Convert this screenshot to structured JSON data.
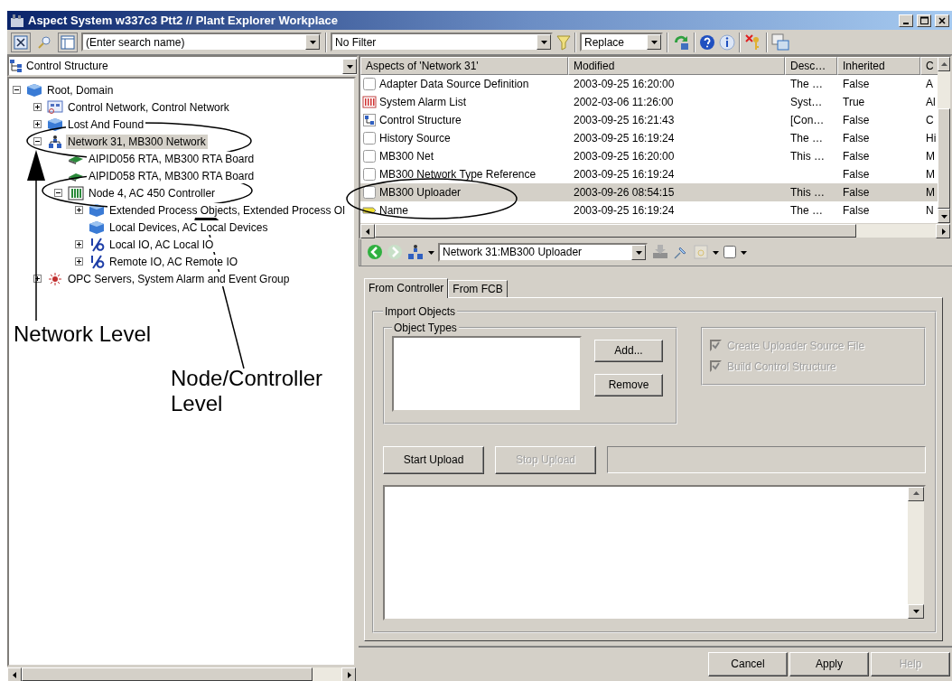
{
  "window": {
    "title": "Aspect System w337c3 Ptt2 // Plant Explorer Workplace"
  },
  "toolbar": {
    "search": {
      "placeholder": "(Enter search name)"
    },
    "filter": {
      "value": "No Filter"
    },
    "mode": {
      "value": "Replace"
    }
  },
  "tree": {
    "selector": "Control Structure",
    "items": [
      {
        "label": "Root, Domain",
        "kind": "domain",
        "expanded": true,
        "selected": false,
        "children": [
          {
            "label": "Control Network, Control Network",
            "kind": "network-folder",
            "expanded": false,
            "selected": false
          },
          {
            "label": "Lost And Found",
            "kind": "folder",
            "expanded": false,
            "selected": false
          },
          {
            "label": "Network 31, MB300 Network",
            "kind": "network",
            "expanded": true,
            "selected": true,
            "children": [
              {
                "label": "AIPID056 RTA, MB300 RTA Board",
                "kind": "board",
                "selected": false
              },
              {
                "label": "AIPID058 RTA, MB300 RTA Board",
                "kind": "board",
                "selected": false
              },
              {
                "label": "Node 4, AC 450 Controller",
                "kind": "controller",
                "expanded": true,
                "selected": false,
                "children": [
                  {
                    "label": "Extended Process Objects, Extended Process Ol",
                    "kind": "folder",
                    "expanded": false,
                    "selected": false
                  },
                  {
                    "label": "Local Devices, AC Local Devices",
                    "kind": "folder",
                    "selected": false
                  },
                  {
                    "label": "Local IO, AC Local IO",
                    "kind": "io",
                    "expanded": false,
                    "selected": false
                  },
                  {
                    "label": "Remote IO, AC Remote IO",
                    "kind": "io",
                    "expanded": false,
                    "selected": false
                  }
                ]
              }
            ]
          },
          {
            "label": "OPC Servers, System Alarm and Event Group",
            "kind": "opc",
            "expanded": false,
            "selected": false
          }
        ]
      }
    ]
  },
  "aspects": {
    "columns": [
      "Aspects of 'Network 31'",
      "Modified",
      "Desc…",
      "Inherited",
      "C"
    ],
    "rows": [
      {
        "kind": "aspect",
        "selected": false,
        "cells": [
          "Adapter Data Source Definition",
          "2003-09-25 16:20:00",
          "The …",
          "False",
          "A"
        ]
      },
      {
        "kind": "alarm",
        "selected": false,
        "cells": [
          "System Alarm List",
          "2002-03-06 11:26:00",
          "Syst…",
          "True",
          "Al"
        ]
      },
      {
        "kind": "structure",
        "selected": false,
        "cells": [
          "Control Structure",
          "2003-09-25 16:21:43",
          "[Con…",
          "False",
          "C"
        ]
      },
      {
        "kind": "aspect",
        "selected": false,
        "cells": [
          "History Source",
          "2003-09-25 16:19:24",
          "The …",
          "False",
          "Hi"
        ]
      },
      {
        "kind": "aspect",
        "selected": false,
        "cells": [
          "MB300 Net",
          "2003-09-25 16:20:00",
          "This …",
          "False",
          "M"
        ]
      },
      {
        "kind": "aspect",
        "selected": false,
        "cells": [
          "MB300 Network Type Reference",
          "2003-09-25 16:19:24",
          "",
          "False",
          "M"
        ]
      },
      {
        "kind": "aspect",
        "selected": true,
        "cells": [
          "MB300 Uploader",
          "2003-09-26 08:54:15",
          "This …",
          "False",
          "M"
        ]
      },
      {
        "kind": "name",
        "selected": false,
        "cells": [
          "Name",
          "2003-09-25 16:19:24",
          "The …",
          "False",
          "N"
        ]
      }
    ]
  },
  "aspect_toolbar": {
    "path": "Network 31:MB300 Uploader"
  },
  "tabs": [
    {
      "label": "From Controller",
      "selected": true
    },
    {
      "label": "From FCB",
      "selected": false
    }
  ],
  "import_group": {
    "title": "Import Objects",
    "object_types": {
      "title": "Object Types",
      "buttons": [
        {
          "label": "Add...",
          "disabled": false
        },
        {
          "label": "Remove",
          "disabled": false
        }
      ]
    },
    "options": [
      {
        "label": "Create Uploader Source File",
        "checked": true,
        "disabled": true
      },
      {
        "label": "Build Control Structure",
        "checked": true,
        "disabled": true
      }
    ],
    "upload_buttons": [
      {
        "label": "Start Upload",
        "disabled": false
      },
      {
        "label": "Stop Upload",
        "disabled": true
      }
    ]
  },
  "dialog_buttons": [
    {
      "label": "Cancel",
      "disabled": false
    },
    {
      "label": "Apply",
      "disabled": false
    },
    {
      "label": "Help",
      "disabled": true
    }
  ],
  "annotations": [
    {
      "label": "Network Level"
    },
    {
      "label": "Node/Controller Level"
    }
  ]
}
